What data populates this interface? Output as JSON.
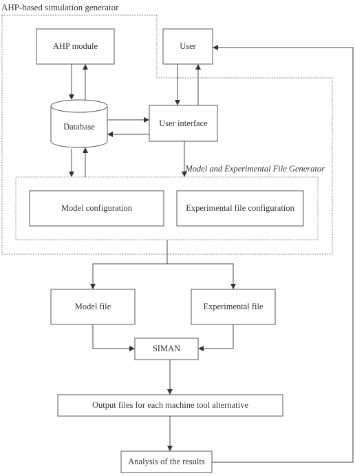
{
  "diagram": {
    "title": "AHP-based simulation generator",
    "subgroup_label": "Model and Experimental File Generator",
    "nodes": {
      "ahp_module": "AHP module",
      "user": "User",
      "database": "Database",
      "user_interface": "User interface",
      "model_configuration": "Model configuration",
      "experimental_file_configuration": "Experimental file configuration",
      "model_file": "Model file",
      "experimental_file": "Experimental file",
      "siman": "SIMAN",
      "output_files": "Output files for each machine tool alternative",
      "analysis": "Analysis of the results"
    },
    "edges": [
      {
        "from": "AHP module",
        "to": "Database"
      },
      {
        "from": "Database",
        "to": "AHP module"
      },
      {
        "from": "User",
        "to": "User interface"
      },
      {
        "from": "User interface",
        "to": "User"
      },
      {
        "from": "Database",
        "to": "User interface"
      },
      {
        "from": "User interface",
        "to": "Database"
      },
      {
        "from": "Database",
        "to": "Model and Experimental File Generator"
      },
      {
        "from": "Model and Experimental File Generator",
        "to": "Database"
      },
      {
        "from": "User interface",
        "to": "Model and Experimental File Generator"
      },
      {
        "from": "Model and Experimental File Generator",
        "to": "Model file"
      },
      {
        "from": "Model and Experimental File Generator",
        "to": "Experimental file"
      },
      {
        "from": "Model file",
        "to": "SIMAN"
      },
      {
        "from": "Experimental file",
        "to": "SIMAN"
      },
      {
        "from": "SIMAN",
        "to": "Output files for each machine tool alternative"
      },
      {
        "from": "Output files for each machine tool alternative",
        "to": "Analysis of the results"
      },
      {
        "from": "Analysis of the results",
        "to": "User"
      }
    ],
    "colors": {
      "line": "#444444",
      "dashed": "#777777",
      "text": "#333333"
    }
  }
}
